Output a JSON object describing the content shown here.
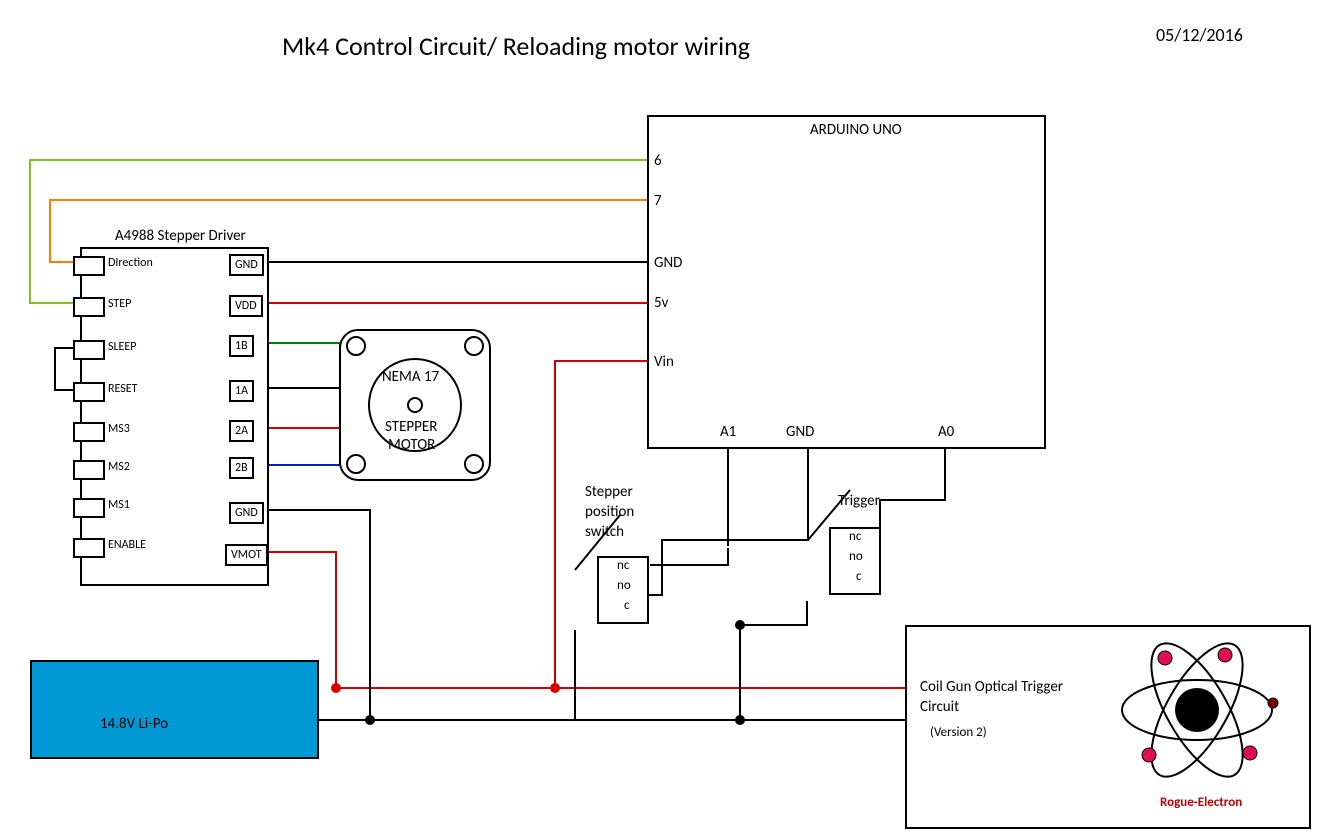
{
  "title": "Mk4 Control Circuit/ Reloading motor wiring",
  "date": "05/12/2016",
  "driver": {
    "label": "A4988 Stepper Driver",
    "left_pins": [
      "DIrection",
      "STEP",
      "SLEEP",
      "RESET",
      "MS3",
      "MS2",
      "MS1",
      "ENABLE"
    ],
    "right_pins": [
      "GND",
      "VDD",
      "1B",
      "1A",
      "2A",
      "2B",
      "GND",
      "VMOT"
    ]
  },
  "motor": {
    "line1": "NEMA 17",
    "line2": "STEPPER",
    "line3": "MOTOR"
  },
  "arduino": {
    "label": "ARDUINO UNO",
    "pins": {
      "d6": "6",
      "d7": "7",
      "gnd": "GND",
      "v5": "5v",
      "vin": "Vin",
      "a1": "A1",
      "gnd2": "GND",
      "a0": "A0"
    }
  },
  "switches": {
    "stepper_pos1": "Stepper",
    "stepper_pos2": "position",
    "stepper_pos3": "switch",
    "trigger": "Trigger",
    "nc": "nc",
    "no": "no",
    "c": "c"
  },
  "optical": {
    "line1": "Coil Gun Optical Trigger",
    "line2": "Circuit",
    "version": "(Version 2)",
    "brand": "Rogue-Electron"
  },
  "battery": "14.8V Li-Po"
}
